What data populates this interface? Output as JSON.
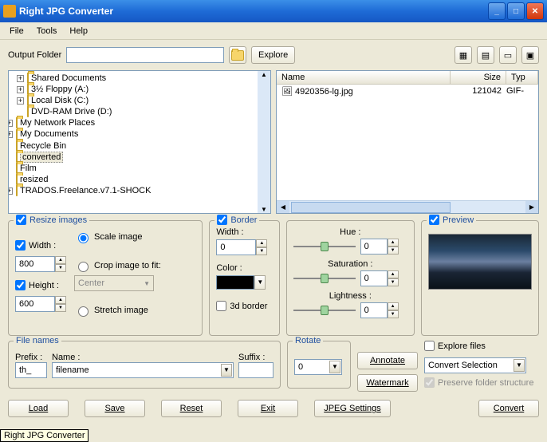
{
  "title": "Right JPG Converter",
  "menu": {
    "file": "File",
    "tools": "Tools",
    "help": "Help"
  },
  "toolbar": {
    "output_label": "Output Folder",
    "output_value": "",
    "explore": "Explore"
  },
  "tree": [
    {
      "label": "Shared Documents",
      "exp": "+",
      "icon": "folder"
    },
    {
      "label": "3½ Floppy (A:)",
      "exp": "+",
      "icon": "drive"
    },
    {
      "label": "Local Disk (C:)",
      "exp": "+",
      "icon": "drive"
    },
    {
      "label": "DVD-RAM Drive (D:)",
      "exp": "",
      "icon": "cd"
    },
    {
      "label": "My Network Places",
      "exp": "+",
      "icon": "net",
      "outdent": 1
    },
    {
      "label": "My Documents",
      "exp": "+",
      "icon": "folder",
      "outdent": 1
    },
    {
      "label": "Recycle Bin",
      "exp": "",
      "icon": "bin",
      "outdent": 1
    },
    {
      "label": "converted",
      "exp": "",
      "icon": "folder",
      "outdent": 1,
      "selected": true
    },
    {
      "label": "Film",
      "exp": "",
      "icon": "folder",
      "outdent": 1
    },
    {
      "label": "resized",
      "exp": "",
      "icon": "folder",
      "outdent": 1
    },
    {
      "label": "TRADOS.Freelance.v7.1-SHOCK",
      "exp": "+",
      "icon": "folder",
      "outdent": 1
    }
  ],
  "filelist": {
    "cols": {
      "name": "Name",
      "size": "Size",
      "type": "Typ"
    },
    "rows": [
      {
        "name": "4920356-lg.jpg",
        "size": "121042",
        "type": "GIF-"
      }
    ]
  },
  "resize": {
    "title": "Resize images",
    "width_label": "Width :",
    "width_value": "800",
    "height_label": "Height :",
    "height_value": "600",
    "scale": "Scale image",
    "crop": "Crop image to fit:",
    "crop_pos": "Center",
    "stretch": "Stretch image"
  },
  "border": {
    "title": "Border",
    "width_label": "Width :",
    "width_value": "0",
    "color_label": "Color :",
    "threed": "3d border"
  },
  "hsl": {
    "hue": "Hue :",
    "sat": "Saturation :",
    "light": "Lightness :",
    "val": "0"
  },
  "preview": {
    "title": "Preview"
  },
  "filenames": {
    "title": "File names",
    "prefix": "Prefix :",
    "prefix_val": "th_",
    "name": "Name :",
    "name_val": "filename",
    "suffix": "Suffix :",
    "suffix_val": ""
  },
  "rotate": {
    "title": "Rotate",
    "val": "0"
  },
  "midbtns": {
    "annotate": "Annotate",
    "watermark": "Watermark"
  },
  "explore": {
    "title": "Explore files",
    "dropdown": "Convert Selection",
    "preserve": "Preserve folder structure"
  },
  "bottom": {
    "load": "Load",
    "save": "Save",
    "reset": "Reset",
    "exit": "Exit",
    "jpeg": "JPEG Settings",
    "convert": "Convert"
  },
  "tooltip": "Right JPG Converter"
}
